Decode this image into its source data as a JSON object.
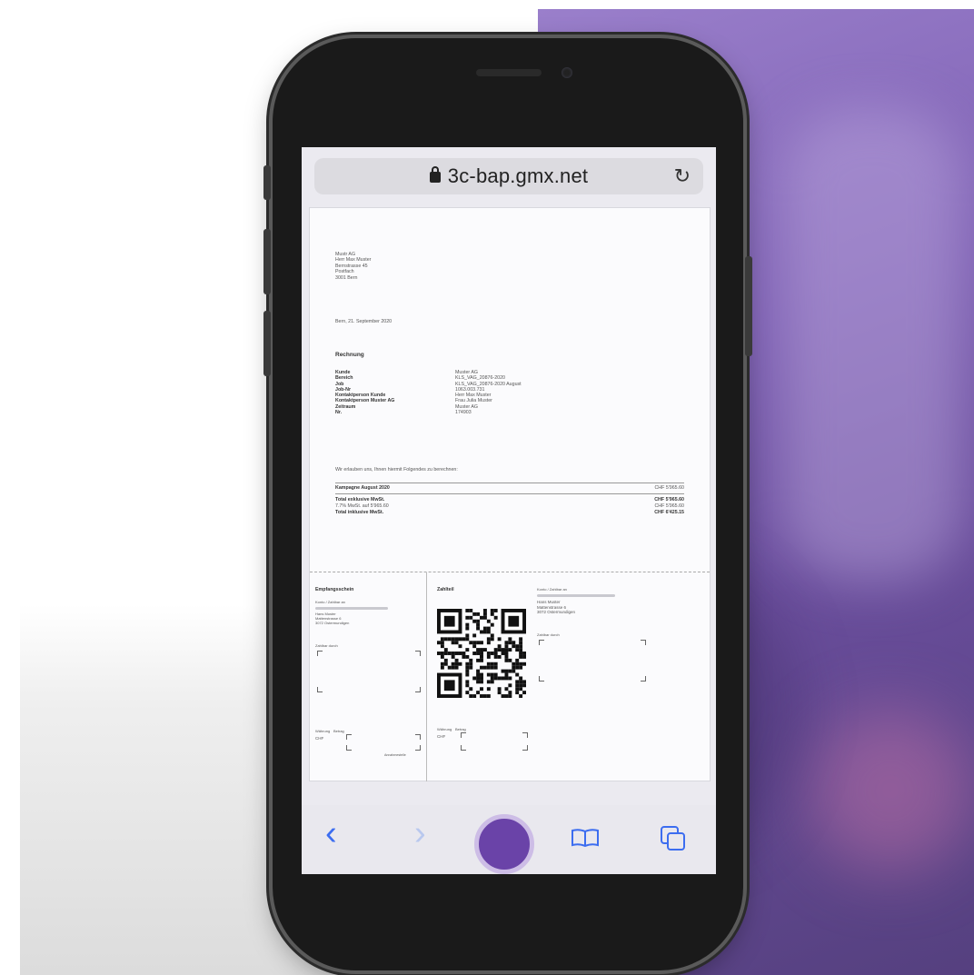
{
  "browser": {
    "url": "3c-bap.gmx.net"
  },
  "invoice": {
    "address_lines": [
      "Mustr AG",
      "Herr Max Muster",
      "Bernstrasse 45",
      "Postfach",
      "3001 Bern"
    ],
    "date": "Bern, 21. September 2020",
    "title": "Rechnung",
    "meta": [
      {
        "key": "Kunde",
        "value": "Muster AG"
      },
      {
        "key": "Bereich",
        "value": "KLS_VAG_20876-2020"
      },
      {
        "key": "Job",
        "value": "KLS_VAG_20876-2020 August"
      },
      {
        "key": "Job-Nr",
        "value": "1063.003.731"
      },
      {
        "key": "Kontaktperson Kunde",
        "value": "Herr Max Muster"
      },
      {
        "key": "Kontaktperson Muster AG",
        "value": "Frau Julia Muster"
      },
      {
        "key": "Zeitraum",
        "value": "Muster AG"
      },
      {
        "key": "Nr.",
        "value": "174903"
      }
    ],
    "intro": "Wir erlauben uns, Ihnen hiermit Folgendes zu berechnen:",
    "line_item": {
      "label": "Kampagne August 2020",
      "amount": "CHF 5'965.60"
    },
    "totals": [
      {
        "label": "Total exklusive MwSt.",
        "amount": "CHF 5'965.60",
        "bold": true
      },
      {
        "label": "7.7% MwSt. auf 5'965.60",
        "amount": "CHF 5'965.60",
        "bold": false
      },
      {
        "label": "Total inklusive MwSt.",
        "amount": "CHF 6'425.15",
        "bold": true
      }
    ]
  },
  "slip": {
    "receipt_title": "Empfangsschein",
    "receipt_account_label": "Konto / Zahlbar an",
    "receipt_lines": [
      "Hans Muster",
      "Mattenstrasse 6",
      "3072 Ostermundigen"
    ],
    "payable_by": "Zahlbar durch",
    "currency_label": "Währung",
    "amount_label": "Betrag",
    "currency": "CHF",
    "acceptance": "Annahmestelle",
    "payment_title": "Zahlteil",
    "payment_account_label": "Konto / Zahlbar an",
    "payment_lines": [
      "Hans Muster",
      "Mattenstrasse 6",
      "3072 Ostermundigen"
    ],
    "payment_payable_by": "Zahlbar durch",
    "payment_currency_label": "Währung",
    "payment_amount_label": "Betrag",
    "payment_currency": "CHF"
  },
  "toolbar": {
    "back_glyph": "‹",
    "forward_glyph": "›"
  },
  "colors": {
    "accent": "#3c6df0",
    "record": "#6a43a8",
    "backdrop_purple": "#7f62b4"
  }
}
